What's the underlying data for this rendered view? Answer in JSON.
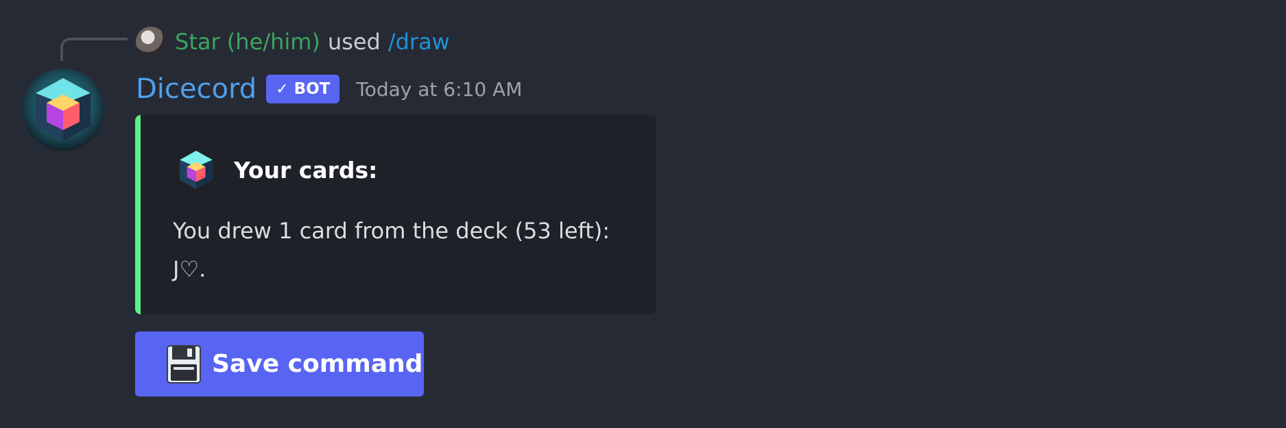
{
  "reply": {
    "username": "Star (he/him)",
    "action": "used",
    "command": "/draw",
    "avatar_icon": "user-avatar"
  },
  "message": {
    "author": "Dicecord",
    "bot_tag": "BOT",
    "verified_icon": "checkmark-icon",
    "timestamp": "Today at 6:10 AM",
    "avatar_icon": "dice-cube-avatar"
  },
  "embed": {
    "accent_color": "#57f287",
    "author_icon": "dice-cube-icon",
    "title": "Your cards:",
    "description_line1": "You drew 1 card from the deck (53 left):",
    "description_line2": "J♡."
  },
  "button": {
    "label": "Save command",
    "icon": "floppy-disk-icon",
    "color": "#5865f2"
  }
}
